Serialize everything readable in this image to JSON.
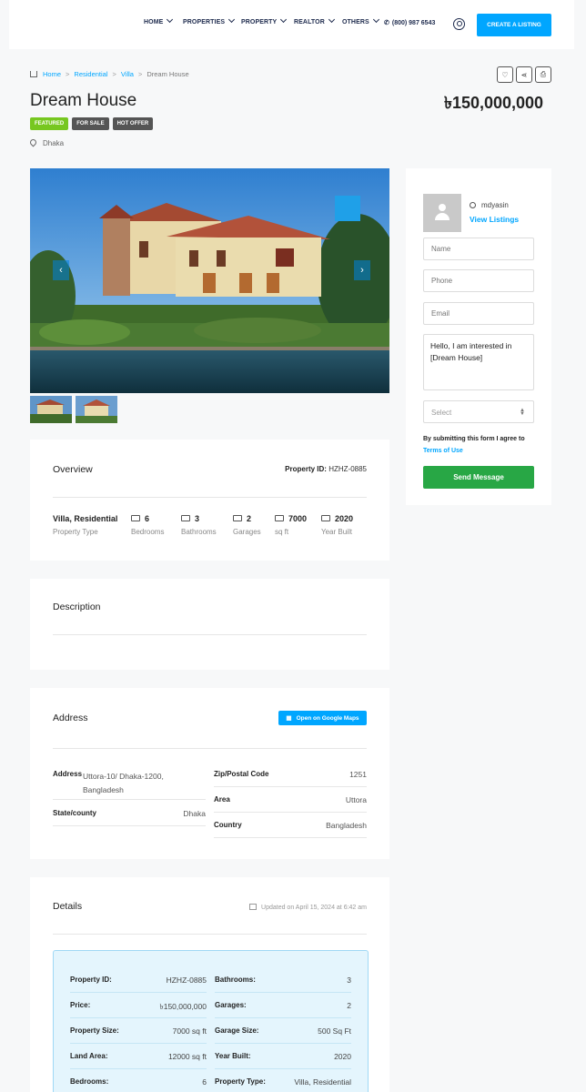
{
  "nav": {
    "items": [
      {
        "label": "HOME"
      },
      {
        "label": "PROPERTIES"
      },
      {
        "label": "PROPERTY"
      },
      {
        "label": "REALTOR"
      },
      {
        "label": "OTHERS"
      }
    ],
    "phone": "(800) 987 6543",
    "cta": "CREATE A LISTING"
  },
  "breadcrumb": {
    "home": "Home",
    "residential": "Residential",
    "villa": "Villa",
    "current": "Dream House"
  },
  "listing": {
    "title": "Dream House",
    "price": "৳150,000,000",
    "badges": [
      "FEATURED",
      "FOR SALE",
      "HOT OFFER"
    ],
    "location": "Dhaka"
  },
  "overview": {
    "title": "Overview",
    "property_id_label": "Property ID:",
    "property_id": "HZHZ-0885",
    "items": [
      {
        "value": "Villa, Residential",
        "label": "Property Type"
      },
      {
        "value": "6",
        "label": "Bedrooms"
      },
      {
        "value": "3",
        "label": "Bathrooms"
      },
      {
        "value": "2",
        "label": "Garages"
      },
      {
        "value": "7000",
        "label": "sq ft"
      },
      {
        "value": "2020",
        "label": "Year Built"
      }
    ]
  },
  "description": {
    "title": "Description"
  },
  "address": {
    "title": "Address",
    "maps_button": "Open on Google Maps",
    "address_label": "Address",
    "address_value": "Uttora-10/ Dhaka-1200, Bangladesh",
    "state_label": "State/county",
    "state_value": "Dhaka",
    "zip_label": "Zip/Postal Code",
    "zip_value": "1251",
    "area_label": "Area",
    "area_value": "Uttora",
    "country_label": "Country",
    "country_value": "Bangladesh"
  },
  "details": {
    "title": "Details",
    "updated": "Updated on April 15, 2024 at 6:42 am",
    "left": [
      {
        "label": "Property ID:",
        "value": "HZHZ-0885"
      },
      {
        "label": "Price:",
        "value": "৳150,000,000"
      },
      {
        "label": "Property Size:",
        "value": "7000 sq ft"
      },
      {
        "label": "Land Area:",
        "value": "12000 sq ft"
      },
      {
        "label": "Bedrooms:",
        "value": "6"
      }
    ],
    "right": [
      {
        "label": "Bathrooms:",
        "value": "3"
      },
      {
        "label": "Garages:",
        "value": "2"
      },
      {
        "label": "Garage Size:",
        "value": "500 Sq Ft"
      },
      {
        "label": "Year Built:",
        "value": "2020"
      },
      {
        "label": "Property Type:",
        "value": "Villa, Residential"
      }
    ]
  },
  "agent": {
    "name": "mdyasin",
    "view_listings": "View Listings",
    "name_placeholder": "Name",
    "phone_placeholder": "Phone",
    "email_placeholder": "Email",
    "message": "Hello, I am interested in [Dream House]",
    "select_placeholder": "Select",
    "agree_text": "By submitting this form I agree to",
    "terms": "Terms of Use",
    "send": "Send Message"
  },
  "colors": {
    "accent": "#00a6ff",
    "featured": "#77c720",
    "badge_dark": "#555555",
    "send": "#28a745"
  }
}
